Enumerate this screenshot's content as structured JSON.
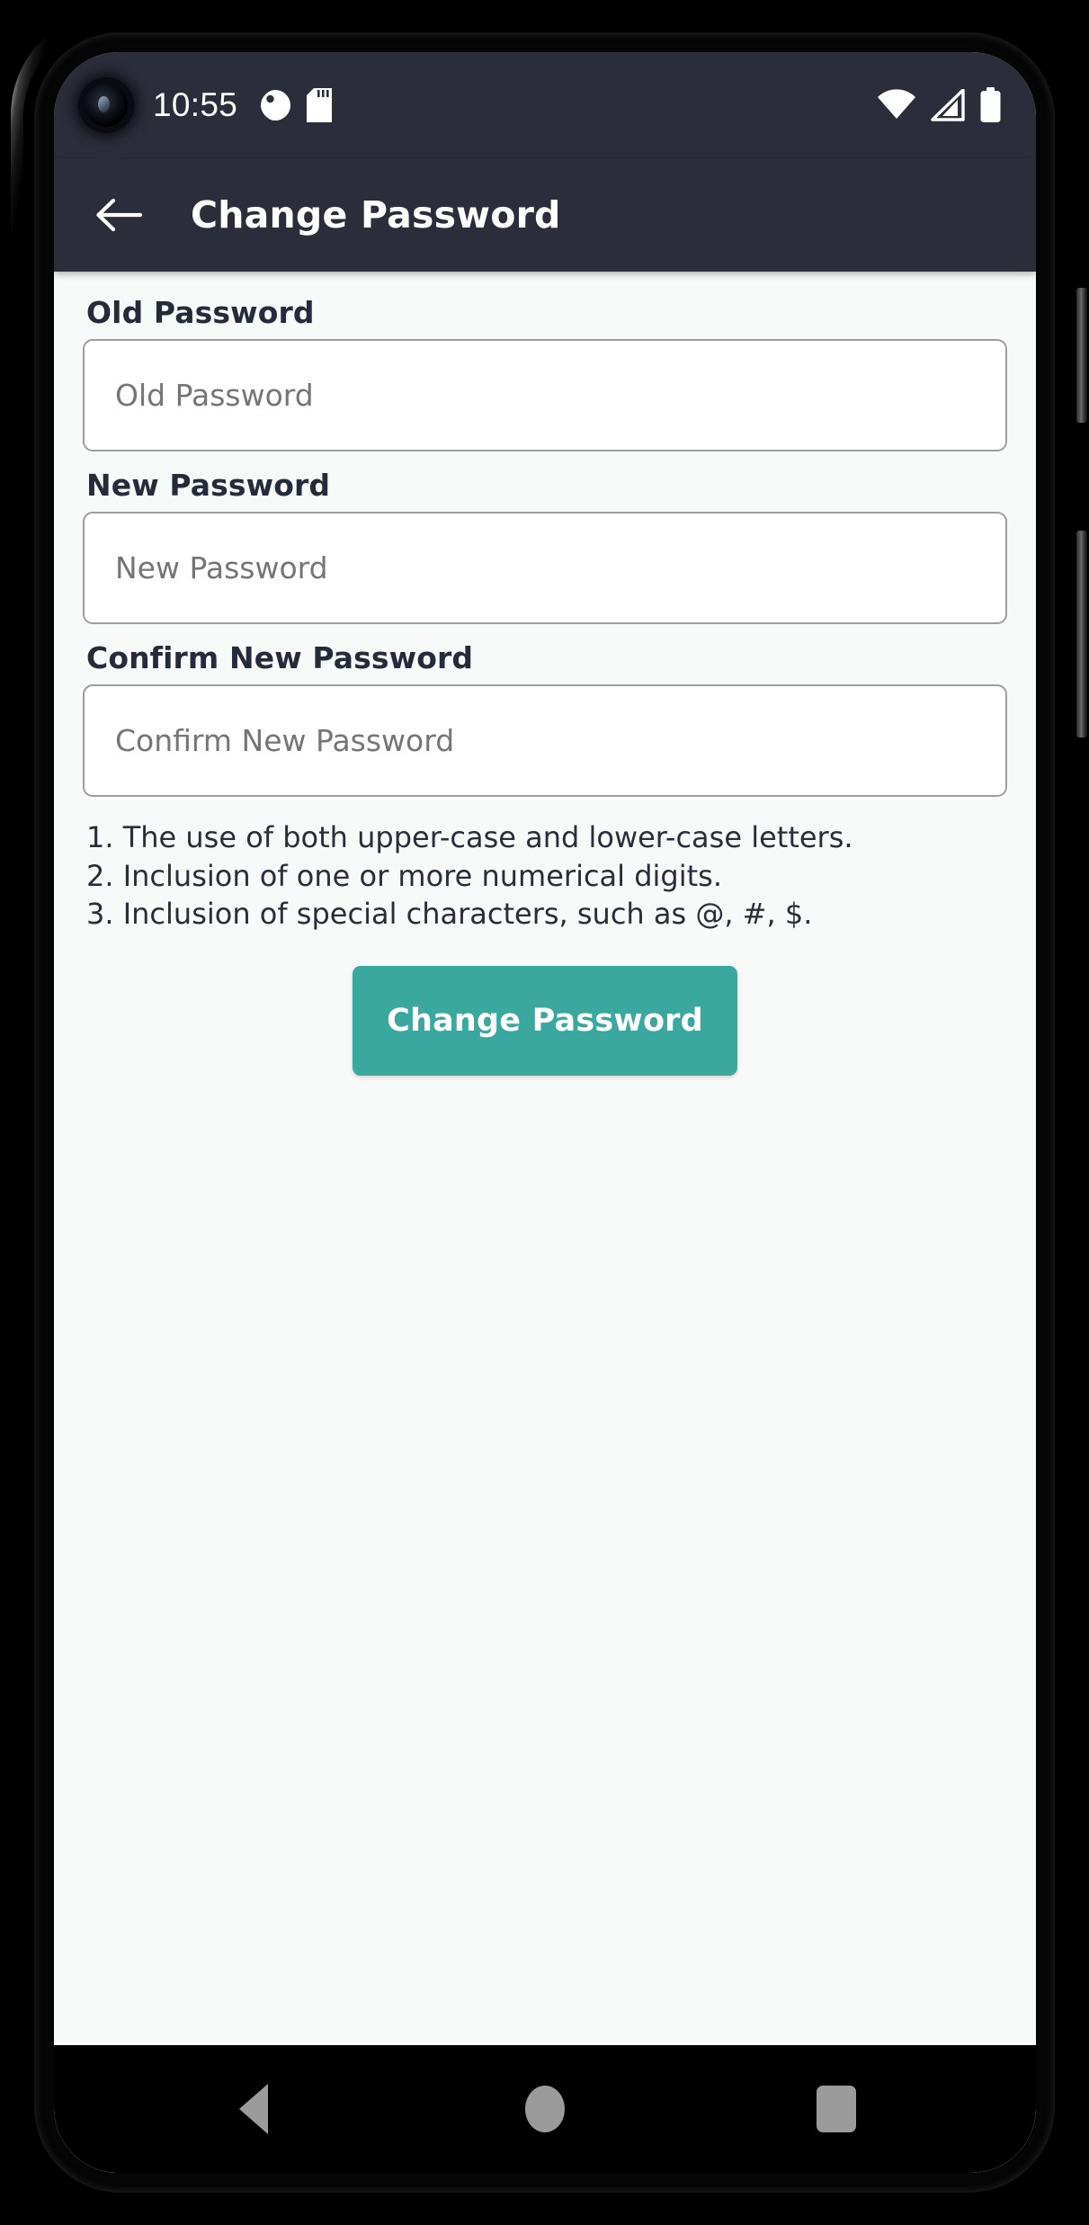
{
  "device": {
    "side_buttons": [
      "power-button",
      "volume-button"
    ]
  },
  "status_bar": {
    "time": "10:55",
    "background": "#2b2d3a",
    "left_icons": [
      "moon-do-not-disturb-icon",
      "sd-card-icon"
    ],
    "right_icons": [
      "wifi-icon",
      "cellular-signal-icon",
      "battery-icon"
    ],
    "camera": "front-camera-punch-hole"
  },
  "app_bar": {
    "back_icon": "arrow-left-icon",
    "title": "Change Password",
    "background": "#2b2d3a",
    "title_color": "#ffffff"
  },
  "form": {
    "background": "#f8f9f9",
    "fields": [
      {
        "label": "Old Password",
        "placeholder": "Old Password",
        "value": ""
      },
      {
        "label": "New Password",
        "placeholder": "New Password",
        "value": ""
      },
      {
        "label": "Confirm New Password",
        "placeholder": "Confirm New Password",
        "value": ""
      }
    ],
    "rules": [
      "1. The use of both upper-case and lower-case letters.",
      "2. Inclusion of one or more numerical digits.",
      "3. Inclusion of special characters, such as @, #, $."
    ],
    "submit": {
      "label": "Change Password",
      "color": "#3aa89e",
      "text_color": "#ffffff"
    }
  },
  "nav_bar": {
    "background": "#000000",
    "icon_color": "#9b9b9b",
    "items": [
      {
        "name": "back-nav-button",
        "icon": "triangle-back-icon"
      },
      {
        "name": "home-nav-button",
        "icon": "circle-home-icon"
      },
      {
        "name": "recents-nav-button",
        "icon": "square-recents-icon"
      }
    ]
  }
}
